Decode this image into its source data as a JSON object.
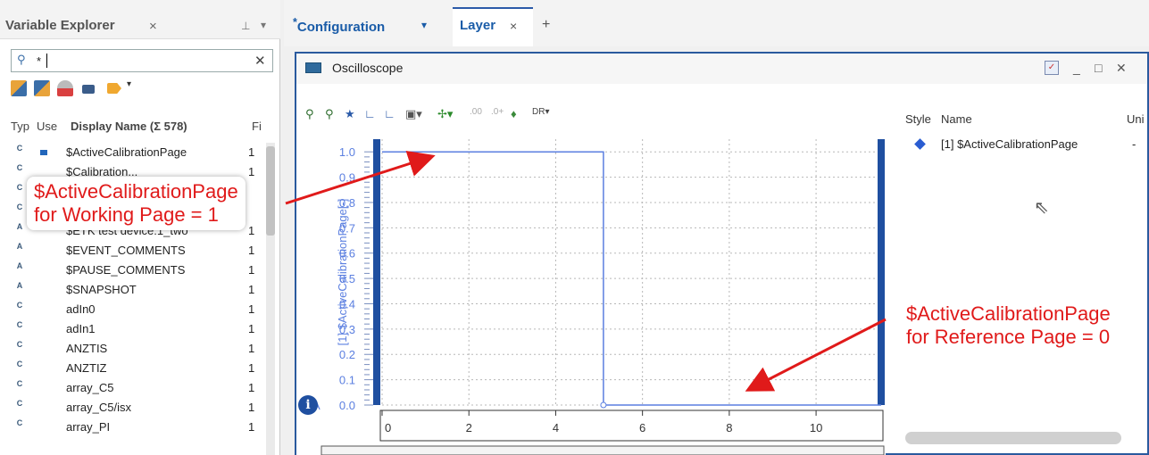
{
  "variable_explorer": {
    "title": "Variable Explorer",
    "close_glyph": "×",
    "pin_glyph": "⊥",
    "menu_glyph": "▾",
    "search": {
      "value": "*",
      "clear_glyph": "✕"
    },
    "toolbar_icons": [
      "table-add-icon",
      "table-edit-icon",
      "filter-clear-icon",
      "variable-icon",
      "tag-icon"
    ],
    "columns": {
      "type": "Typ",
      "use": "Use",
      "display_name": "Display Name (Σ 578)",
      "fi": "Fi"
    },
    "rows": [
      {
        "type": "C",
        "name": "$ActiveCalibrationPage",
        "fi": "1",
        "used": true
      },
      {
        "type": "C",
        "name": "$Calibration...",
        "fi": "1",
        "used": false
      },
      {
        "type": "C",
        "name": "",
        "fi": "",
        "used": false
      },
      {
        "type": "C",
        "name": "",
        "fi": "",
        "used": false
      },
      {
        "type": "A",
        "name": "$ETK test device:1_two",
        "fi": "1",
        "used": false
      },
      {
        "type": "A",
        "name": "$EVENT_COMMENTS",
        "fi": "1",
        "used": false
      },
      {
        "type": "A",
        "name": "$PAUSE_COMMENTS",
        "fi": "1",
        "used": false
      },
      {
        "type": "A",
        "name": "$SNAPSHOT",
        "fi": "1",
        "used": false
      },
      {
        "type": "C",
        "name": "adIn0",
        "fi": "1",
        "used": false
      },
      {
        "type": "C",
        "name": "adIn1",
        "fi": "1",
        "used": false
      },
      {
        "type": "C",
        "name": "ANZTIS",
        "fi": "1",
        "used": false
      },
      {
        "type": "C",
        "name": "ANZTIZ",
        "fi": "1",
        "used": false
      },
      {
        "type": "C",
        "name": "array_C5",
        "fi": "1",
        "used": false
      },
      {
        "type": "C",
        "name": "array_C5/isx",
        "fi": "1",
        "used": false
      },
      {
        "type": "C",
        "name": "array_PI",
        "fi": "1",
        "used": false
      }
    ]
  },
  "tabs": {
    "configuration": {
      "label": "Configuration",
      "modified_mark": "*",
      "menu_glyph": "▾"
    },
    "layer": {
      "label": "Layer",
      "close_glyph": "×"
    },
    "add_glyph": "+"
  },
  "oscilloscope": {
    "title": "Oscilloscope",
    "window_buttons": {
      "minimize": "_",
      "maximize": "□",
      "close": "✕"
    },
    "toolbar_dr_label": "DR",
    "legend": {
      "headers": {
        "style": "Style",
        "name": "Name",
        "unit": "Uni"
      },
      "rows": [
        {
          "name": "[1] $ActiveCalibrationPage",
          "unit": "-",
          "color": "#2a5cd1"
        }
      ]
    },
    "y_axis_label": "[1] $ActiveCalibrationPage[-]",
    "y_axis_marker": "A",
    "info_glyph": "i"
  },
  "chart_data": {
    "type": "line",
    "title": "",
    "xlabel": "",
    "ylabel": "[1] $ActiveCalibrationPage[-]",
    "xlim": [
      0,
      11.5
    ],
    "ylim": [
      0,
      1.05
    ],
    "x_ticks": [
      "0",
      "2",
      "4",
      "6",
      "8",
      "10"
    ],
    "y_ticks": [
      "0.0",
      "0.1",
      "0.2",
      "0.3",
      "0.4",
      "0.5",
      "0.6",
      "0.7",
      "0.8",
      "0.9",
      "1.0"
    ],
    "grid": true,
    "series": [
      {
        "name": "[1] $ActiveCalibrationPage",
        "color": "#5b7fe0",
        "x": [
          0,
          5.1,
          5.1,
          11.5
        ],
        "y": [
          1.0,
          1.0,
          0.0,
          0.0
        ]
      }
    ]
  },
  "annotations": {
    "working_page": "$ActiveCalibrationPage\nfor Working Page = 1",
    "reference_page": "$ActiveCalibrationPage\nfor Reference Page = 0",
    "color": "#e01a1a"
  }
}
